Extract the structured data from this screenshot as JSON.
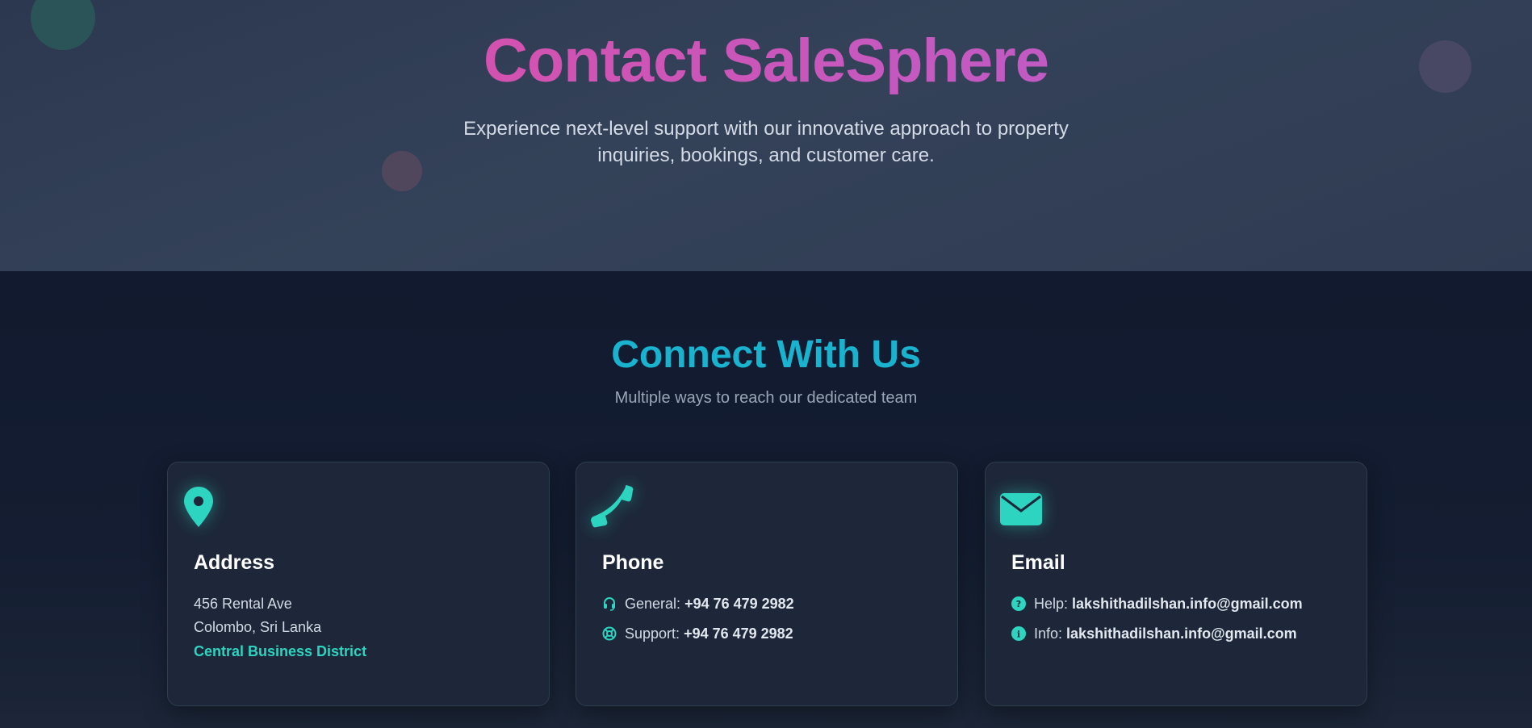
{
  "hero": {
    "title": "Contact SaleSphere",
    "subtitle": "Experience next-level support with our innovative approach to property inquiries, bookings, and customer care."
  },
  "section": {
    "title": "Connect With Us",
    "subtitle": "Multiple ways to reach our dedicated team"
  },
  "cards": {
    "address": {
      "icon": "map-pin-icon",
      "title": "Address",
      "line1": "456 Rental Ave",
      "line2": "Colombo, Sri Lanka",
      "highlight": "Central Business District"
    },
    "phone": {
      "icon": "phone-icon",
      "title": "Phone",
      "general_label": "General:",
      "general_value": "+94 76 479 2982",
      "support_label": "Support:",
      "support_value": "+94 76 479 2982"
    },
    "email": {
      "icon": "envelope-icon",
      "title": "Email",
      "help_label": "Help:",
      "help_value": "lakshithadilshan.info@gmail.com",
      "info_label": "Info:",
      "info_value": "lakshithadilshan.info@gmail.com"
    }
  },
  "colors": {
    "accent": "#2dd4bf",
    "heading_cyan": "#19b3d0",
    "title_gradient_start": "#e44a9e",
    "title_gradient_end": "#b45ccc"
  }
}
